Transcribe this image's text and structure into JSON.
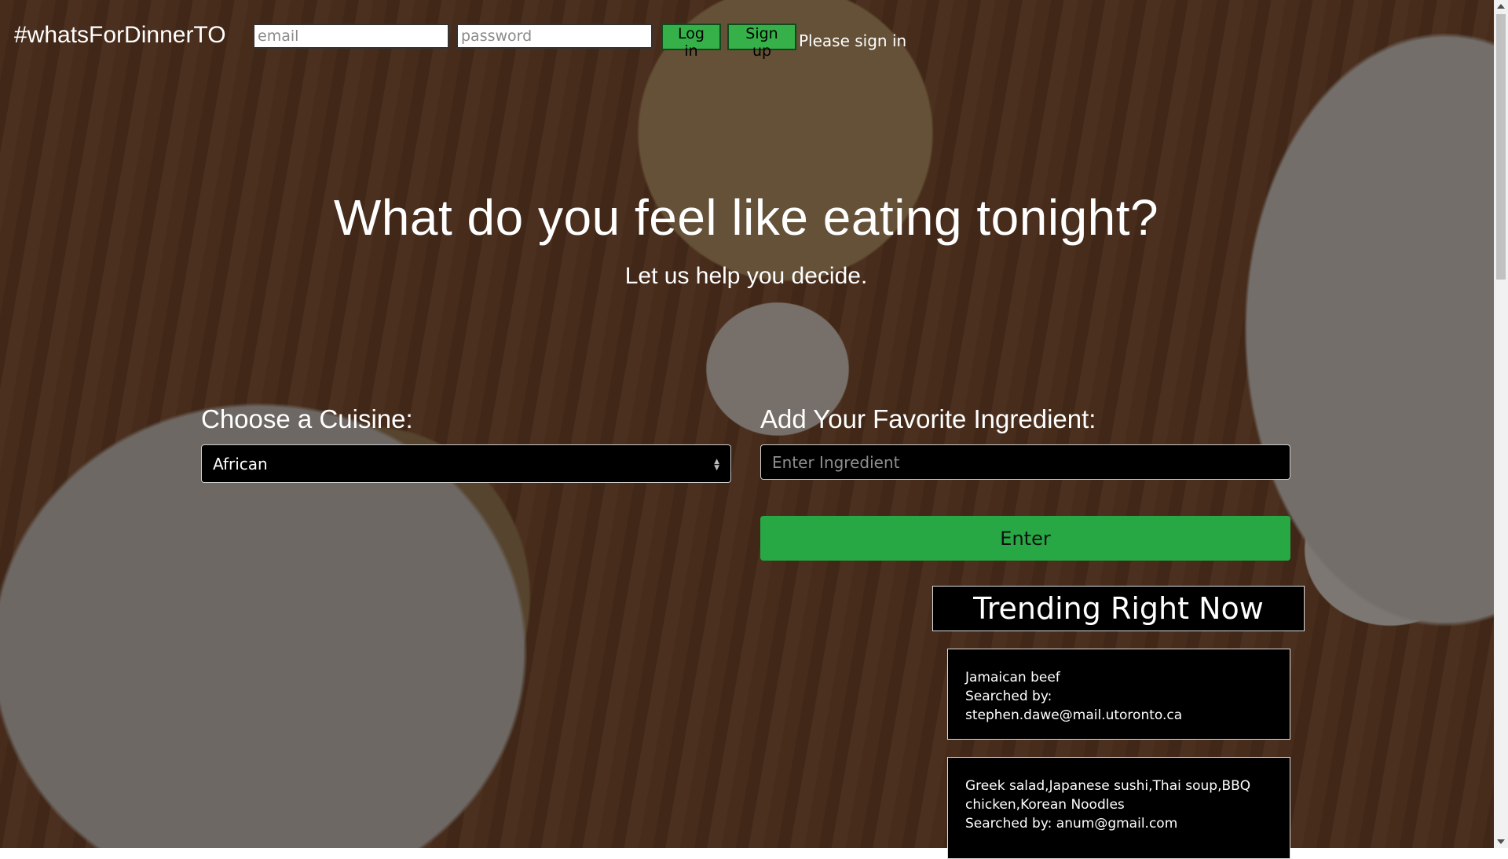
{
  "header": {
    "brand": "#whatsForDinnerTO",
    "email_placeholder": "email",
    "password_placeholder": "password",
    "login_label": "Log in",
    "signup_label": "Sign up",
    "status": "Please sign in"
  },
  "hero": {
    "title": "What do you feel like eating tonight?",
    "subtitle": "Let us help you decide."
  },
  "form": {
    "cuisine_label": "Choose a Cuisine:",
    "cuisine_selected": "African",
    "ingredient_label": "Add Your Favorite Ingredient:",
    "ingredient_placeholder": "Enter Ingredient",
    "enter_label": "Enter"
  },
  "trending": {
    "heading": "Trending Right Now",
    "items": [
      {
        "query": "Jamaican beef",
        "searched_by": "Searched by: stephen.dawe@mail.utoronto.ca"
      },
      {
        "query": "Greek salad,Japanese sushi,Thai soup,BBQ chicken,Korean Noodles",
        "searched_by": "Searched by: anum@gmail.com"
      }
    ]
  },
  "colors": {
    "accent_green": "#28a745",
    "button_green": "#36b14a",
    "panel_black": "#000000"
  }
}
